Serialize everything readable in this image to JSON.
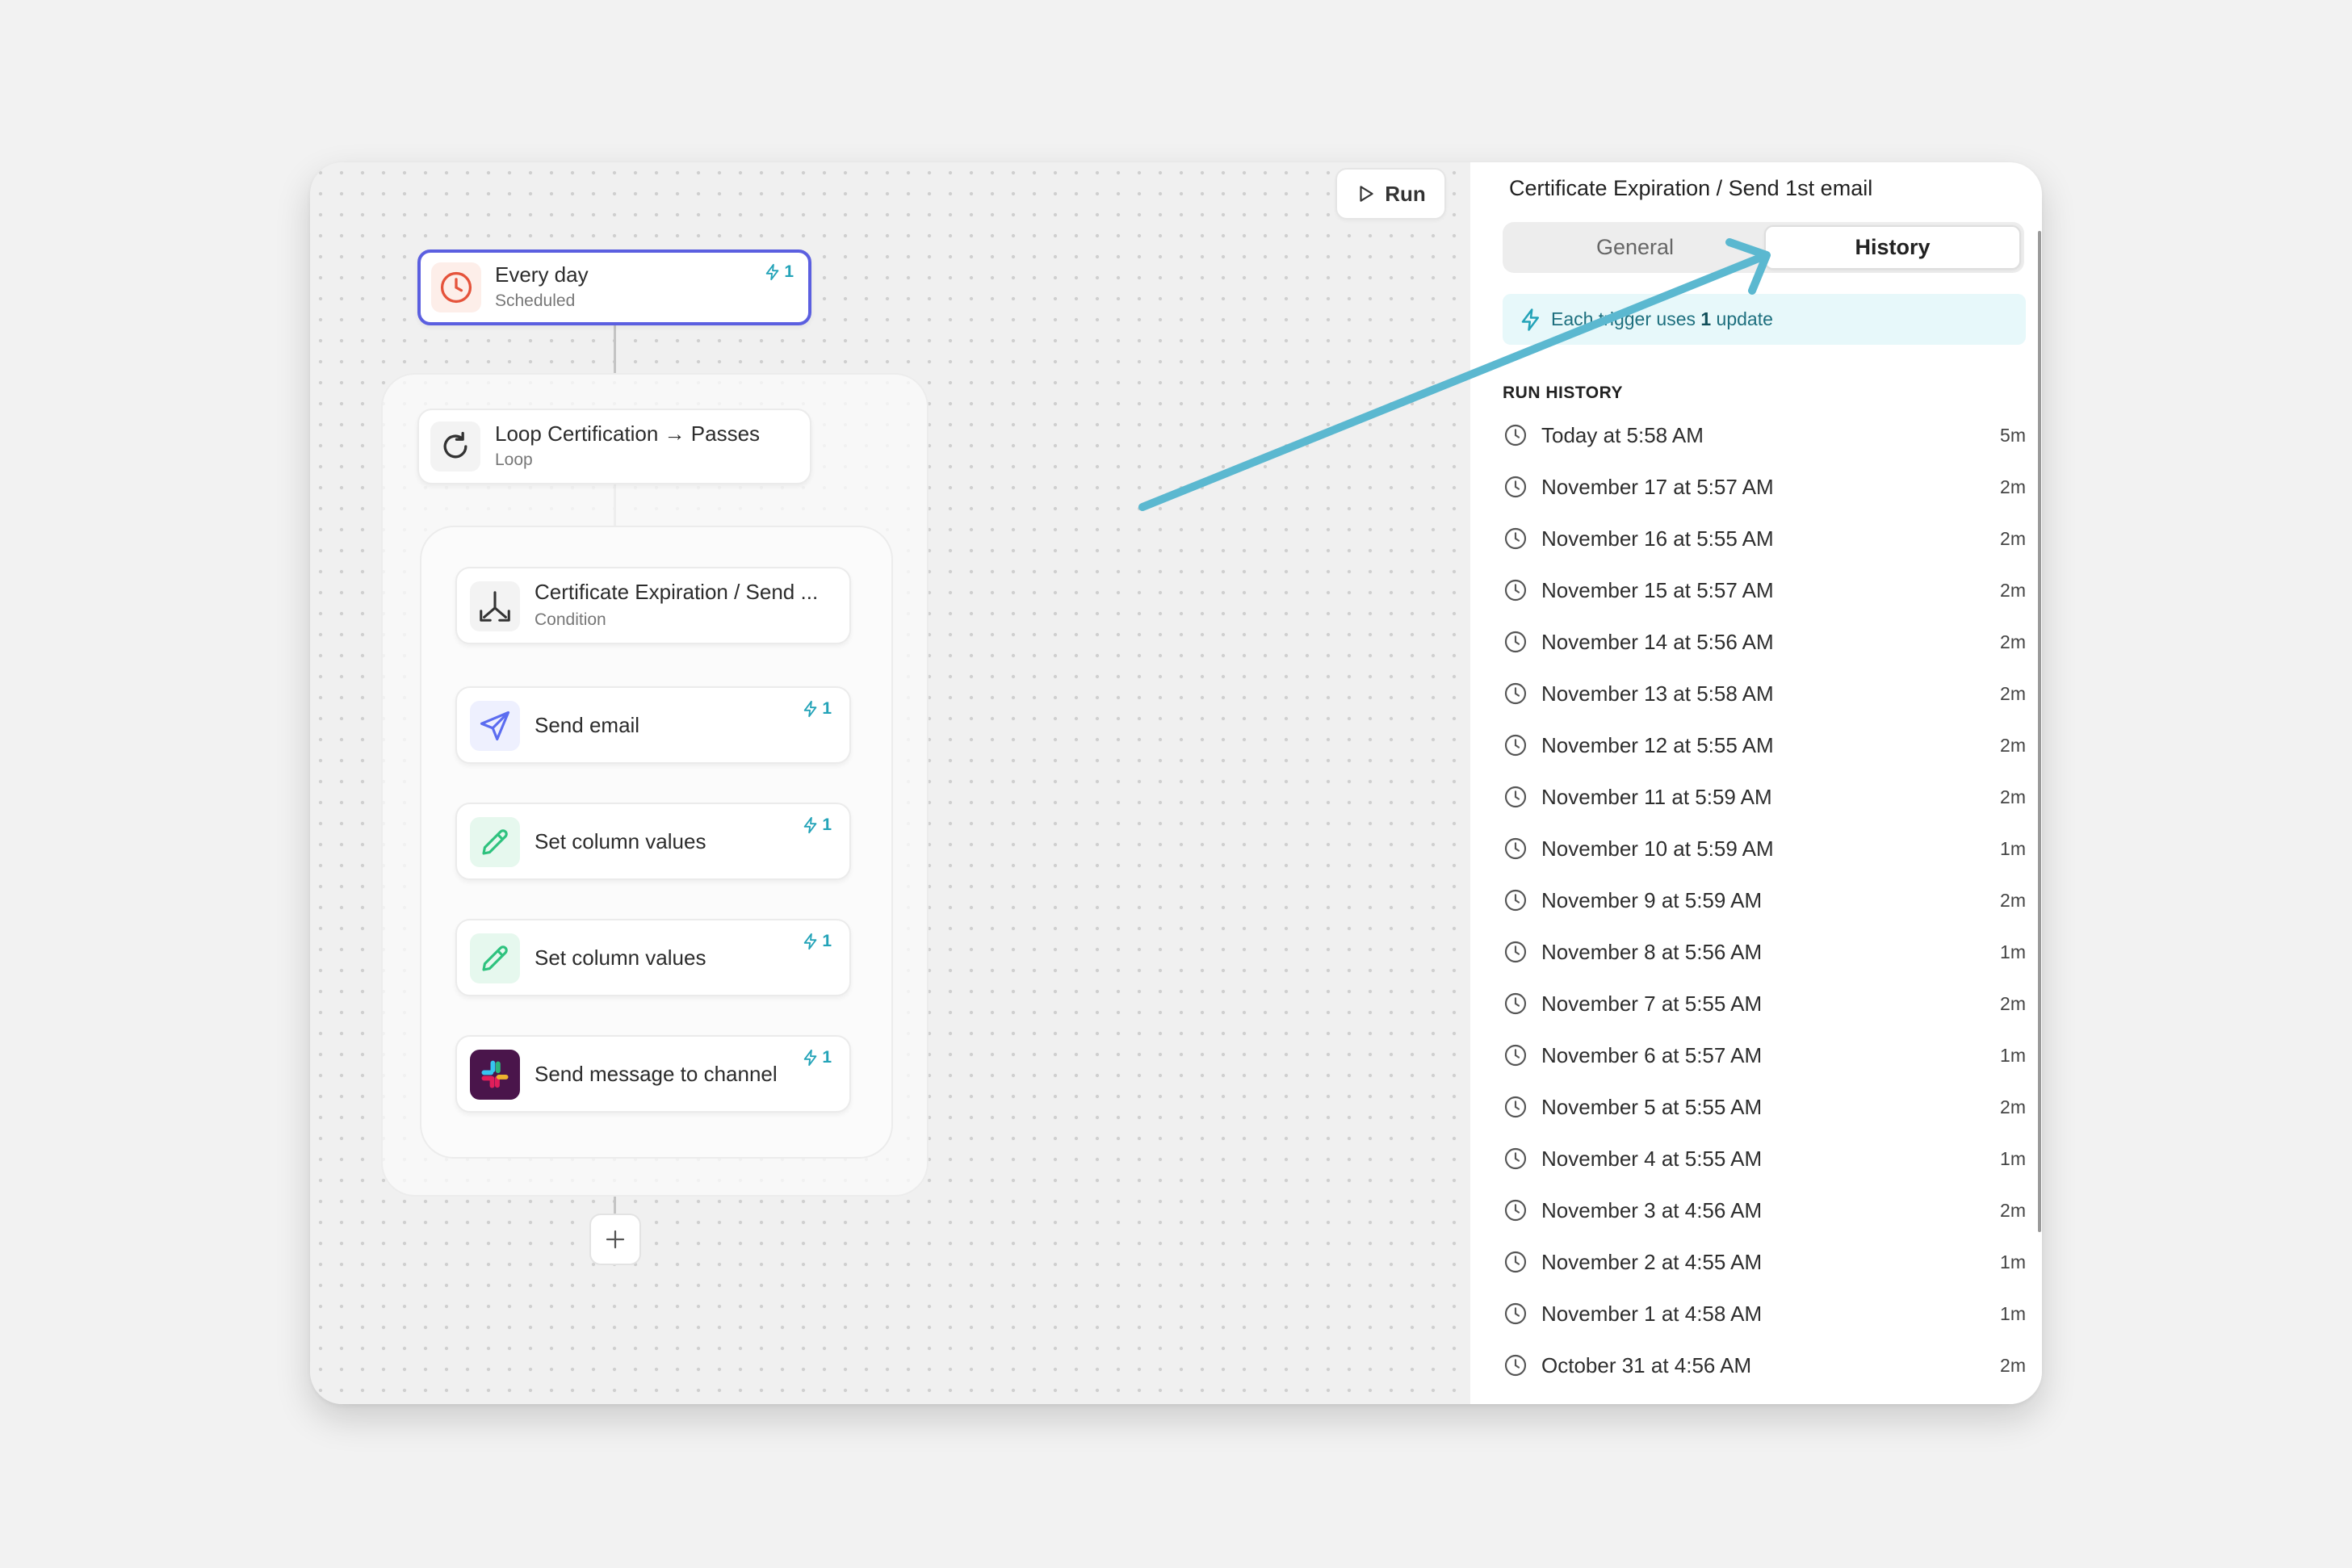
{
  "toolbar": {
    "run_label": "Run"
  },
  "canvas": {
    "trigger": {
      "title": "Every day",
      "subtitle": "Scheduled",
      "badge": "1"
    },
    "loop": {
      "title": "Loop Certification → Passes",
      "subtitle": "Loop"
    },
    "steps": [
      {
        "title": "Certificate Expiration / Send ...",
        "subtitle": "Condition",
        "icon": "condition-split-icon",
        "badge": ""
      },
      {
        "title": "Send email",
        "subtitle": "",
        "icon": "paper-plane-icon",
        "badge": "1"
      },
      {
        "title": "Set column values",
        "subtitle": "",
        "icon": "pencil-icon",
        "badge": "1"
      },
      {
        "title": "Set column values",
        "subtitle": "",
        "icon": "pencil-icon",
        "badge": "1"
      },
      {
        "title": "Send message to channel",
        "subtitle": "",
        "icon": "slack-icon",
        "badge": "1"
      }
    ],
    "add_button_icon": "plus-icon"
  },
  "panel": {
    "title": "Certificate Expiration / Send 1st email",
    "tabs": [
      {
        "label": "General",
        "active": false
      },
      {
        "label": "History",
        "active": true
      }
    ],
    "info": {
      "prefix": "Each trigger uses ",
      "count": "1",
      "suffix": " update"
    },
    "run_history_heading": "RUN HISTORY",
    "history": [
      {
        "when": "Today at 5:58 AM",
        "duration": "5m"
      },
      {
        "when": "November 17 at 5:57 AM",
        "duration": "2m"
      },
      {
        "when": "November 16 at 5:55 AM",
        "duration": "2m"
      },
      {
        "when": "November 15 at 5:57 AM",
        "duration": "2m"
      },
      {
        "when": "November 14 at 5:56 AM",
        "duration": "2m"
      },
      {
        "when": "November 13 at 5:58 AM",
        "duration": "2m"
      },
      {
        "when": "November 12 at 5:55 AM",
        "duration": "2m"
      },
      {
        "when": "November 11 at 5:59 AM",
        "duration": "2m"
      },
      {
        "when": "November 10 at 5:59 AM",
        "duration": "1m"
      },
      {
        "when": "November 9 at 5:59 AM",
        "duration": "2m"
      },
      {
        "when": "November 8 at 5:56 AM",
        "duration": "1m"
      },
      {
        "when": "November 7 at 5:55 AM",
        "duration": "2m"
      },
      {
        "when": "November 6 at 5:57 AM",
        "duration": "1m"
      },
      {
        "when": "November 5 at 5:55 AM",
        "duration": "2m"
      },
      {
        "when": "November 4 at 5:55 AM",
        "duration": "1m"
      },
      {
        "when": "November 3 at 4:56 AM",
        "duration": "2m"
      },
      {
        "when": "November 2 at 4:55 AM",
        "duration": "1m"
      },
      {
        "when": "November 1 at 4:58 AM",
        "duration": "1m"
      },
      {
        "when": "October 31 at 4:56 AM",
        "duration": "2m"
      }
    ]
  },
  "colors": {
    "accent_teal": "#23a3b8",
    "trigger_border": "#5b5fe0",
    "annotation_arrow": "#5bb8d0",
    "clock_red": "#e5533b",
    "send_blue": "#5b6cf0",
    "pencil_green": "#2ec27e"
  }
}
